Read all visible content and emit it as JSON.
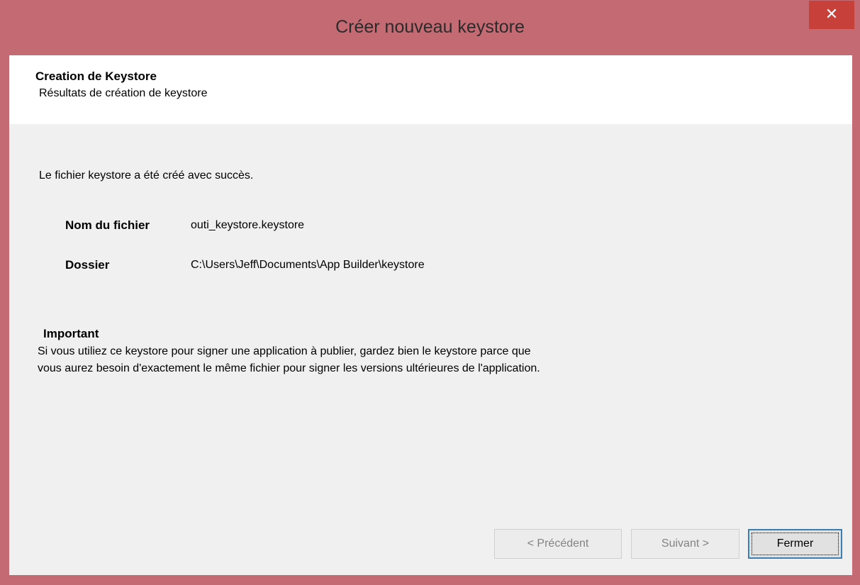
{
  "window": {
    "title": "Créer nouveau keystore",
    "close_glyph": "✕"
  },
  "header": {
    "title": "Creation de Keystore",
    "subtitle": "Résultats de création de keystore"
  },
  "content": {
    "success_message": "Le fichier keystore a été créé avec succès.",
    "file_name_label": "Nom du fichier",
    "file_name_value": "outi_keystore.keystore",
    "folder_label": "Dossier",
    "folder_value": "C:\\Users\\Jeff\\Documents\\App Builder\\keystore",
    "important_title": "Important",
    "important_line1": "Si vous utiliez ce keystore pour signer une application à publier, gardez bien le keystore parce que",
    "important_line2": "vous aurez besoin d'exactement le même fichier pour signer les versions ultérieures de l'application."
  },
  "buttons": {
    "previous": "< Précédent",
    "next": "Suivant >",
    "close": "Fermer"
  },
  "colors": {
    "titlebar": "#c46a73",
    "close_button": "#c7403a",
    "client_background": "#f0f0f0",
    "header_background": "#ffffff",
    "default_button_border": "#3c7fb1"
  }
}
